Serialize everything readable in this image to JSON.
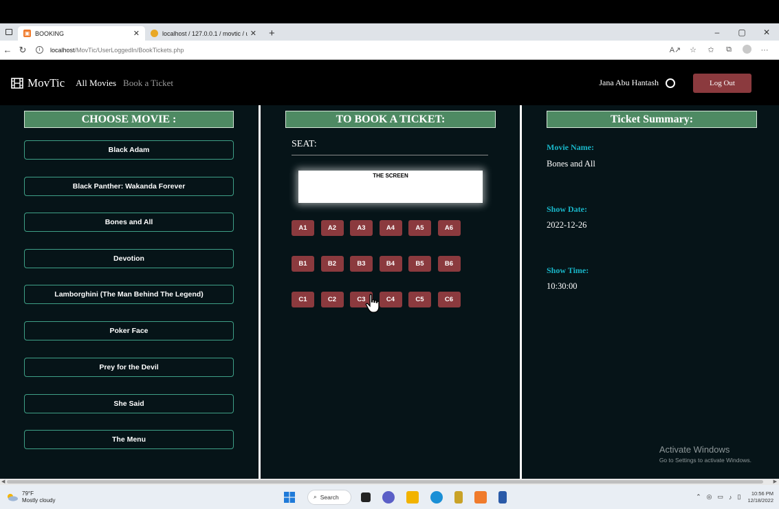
{
  "browser": {
    "tabs": [
      {
        "label": "BOOKING",
        "active": true
      },
      {
        "label": "localhost / 127.0.0.1 / movtic / u",
        "active": false
      }
    ],
    "address": {
      "host": "localhost",
      "path": "/MovTic/UserLoggedIn/BookTickets.php"
    }
  },
  "site": {
    "brand": "MovTic",
    "nav": [
      {
        "label": "All Movies"
      },
      {
        "label": "Book a Ticket"
      }
    ],
    "username": "Jana Abu Hantash",
    "logout_label": "Log Out"
  },
  "choose": {
    "title": "CHOOSE MOVIE :",
    "movies": [
      "Black Adam",
      "Black Panther: Wakanda Forever",
      "Bones and All",
      "Devotion",
      "Lamborghini (The Man Behind The Legend)",
      "Poker Face",
      "Prey for the Devil",
      "She Said",
      "The Menu"
    ]
  },
  "booking": {
    "title": "TO BOOK A TICKET:",
    "seat_label": "SEAT:",
    "screen_label": "THE SCREEN",
    "rows": [
      [
        "A1",
        "A2",
        "A3",
        "A4",
        "A5",
        "A6"
      ],
      [
        "B1",
        "B2",
        "B3",
        "B4",
        "B5",
        "B6"
      ],
      [
        "C1",
        "C2",
        "C3",
        "C4",
        "C5",
        "C6"
      ]
    ]
  },
  "summary": {
    "title": "Ticket Summary:",
    "movie_name_label": "Movie Name:",
    "movie_name": "Bones and All",
    "show_date_label": "Show Date:",
    "show_date": "2022-12-26",
    "show_time_label": "Show Time:",
    "show_time": "10:30:00"
  },
  "watermark": {
    "line1": "Activate Windows",
    "line2": "Go to Settings to activate Windows."
  },
  "taskbar": {
    "temp": "79°F",
    "weather": "Mostly cloudy",
    "search_label": "Search",
    "time": "10:56 PM",
    "date": "12/18/2022"
  }
}
